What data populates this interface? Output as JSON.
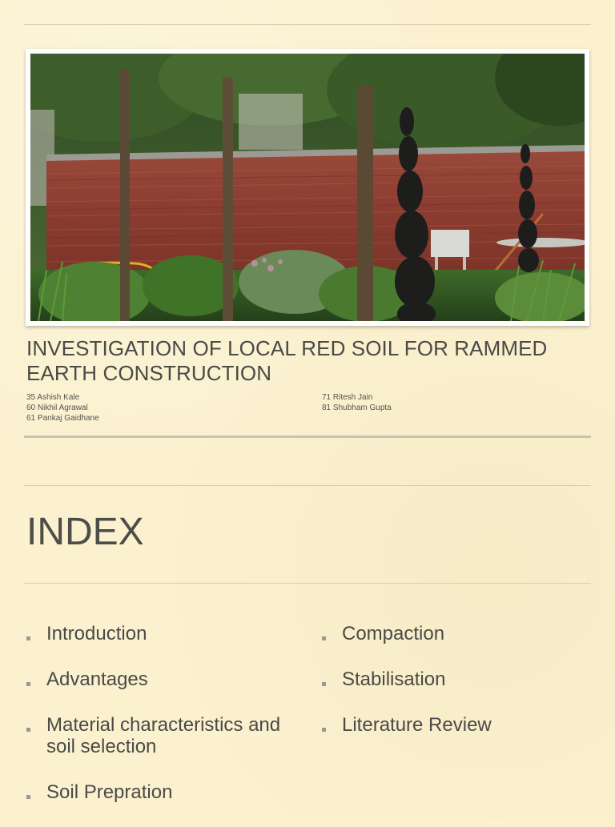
{
  "slide1": {
    "title": "INVESTIGATION OF LOCAL RED SOIL FOR RAMMED EARTH CONSTRUCTION",
    "authors_left": [
      "35 Ashish Kale",
      "60 Nikhil Agrawal",
      "61 Pankaj Gaidhane"
    ],
    "authors_right": [
      "71 Ritesh Jain",
      "81 Shubham Gupta"
    ]
  },
  "slide2": {
    "title": "INDEX",
    "items_left": [
      "Introduction",
      "Advantages",
      "Material characteristics and soil selection",
      "Soil Prepration"
    ],
    "items_right": [
      "Compaction",
      "Stabilisation",
      "Literature Review"
    ]
  },
  "colors": {
    "background": "#fbf1cf",
    "text": "#4a4a46",
    "wall": "#8e3f32"
  }
}
